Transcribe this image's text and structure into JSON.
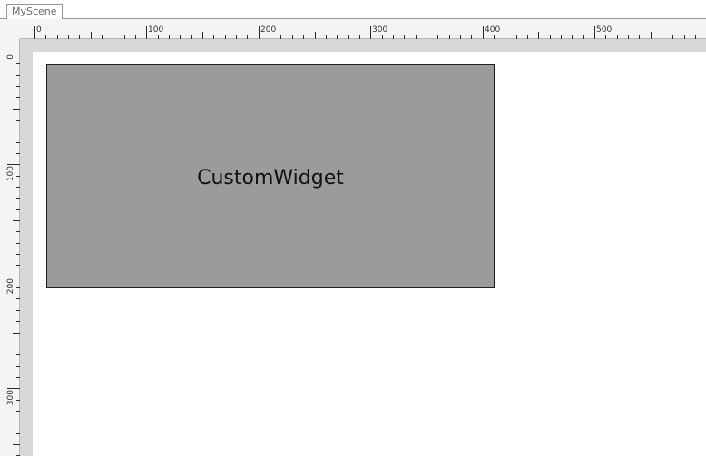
{
  "tabs": [
    {
      "label": "MyScene"
    }
  ],
  "ruler": {
    "unit_labels": [
      "0",
      "100",
      "200",
      "300",
      "400",
      "500"
    ]
  },
  "left_ruler": {
    "unit_labels": [
      "0",
      "100",
      "200",
      "300"
    ]
  },
  "scene": {
    "widget": {
      "label": "CustomWidget",
      "fill_color": "#9b9b9b",
      "border_color": "#1e1e1e"
    }
  },
  "colors": {
    "ruler_background": "#f4f4f4",
    "frame": "#d8d8d8",
    "canvas": "#ffffff"
  }
}
